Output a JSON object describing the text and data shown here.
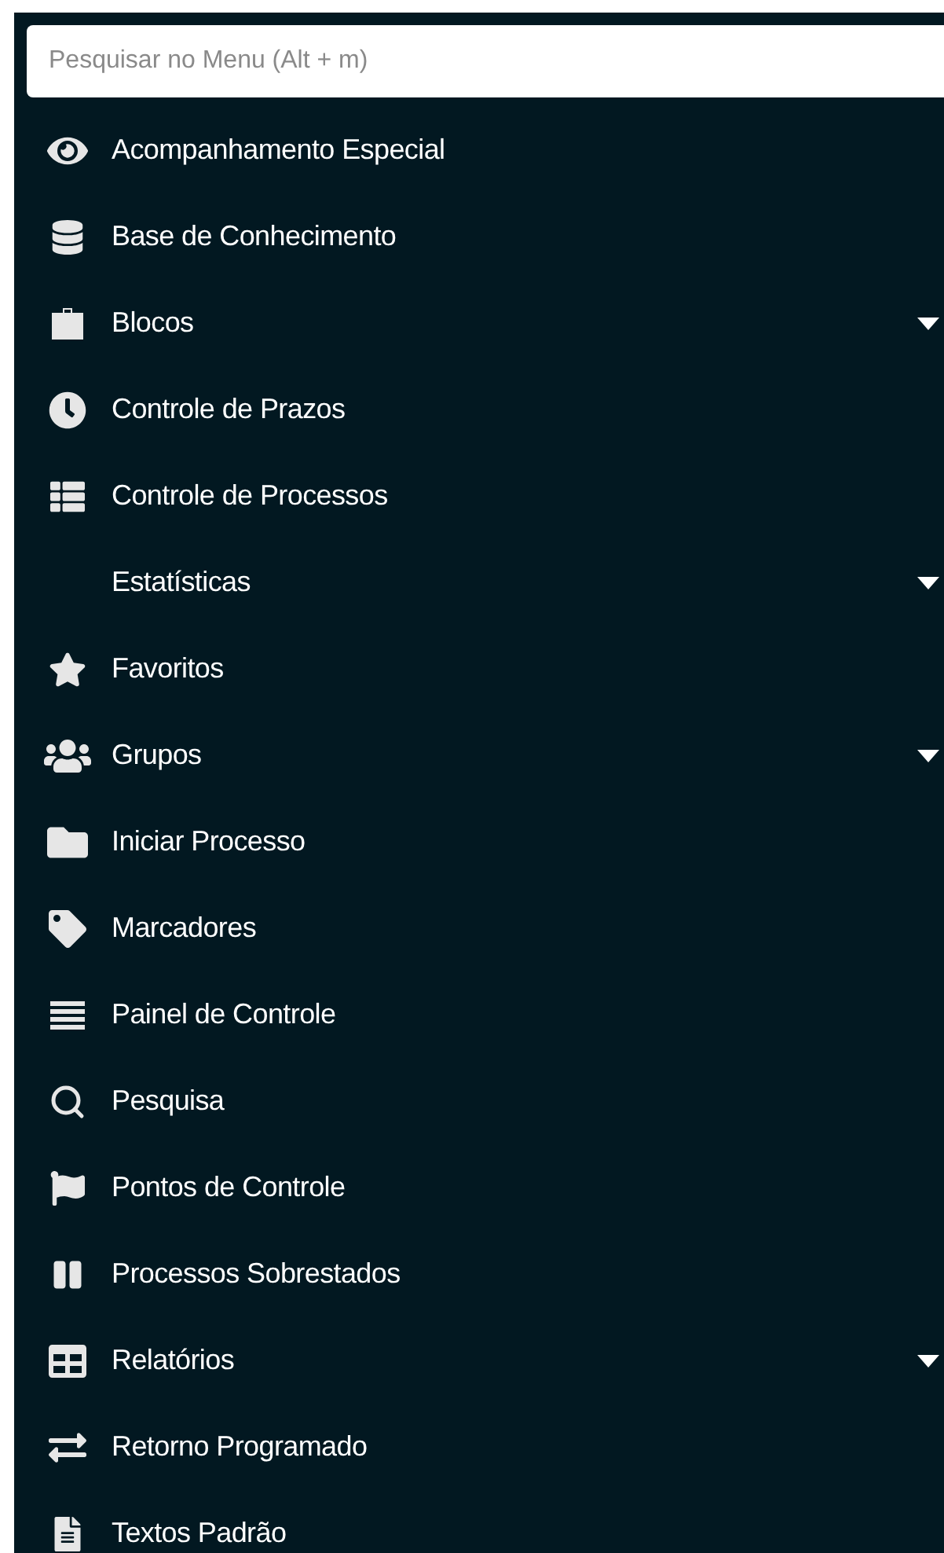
{
  "search": {
    "placeholder": "Pesquisar no Menu (Alt + m)"
  },
  "menu": [
    {
      "label": "Acompanhamento Especial",
      "has_submenu": false
    },
    {
      "label": "Base de Conhecimento",
      "has_submenu": false
    },
    {
      "label": "Blocos",
      "has_submenu": true
    },
    {
      "label": "Controle de Prazos",
      "has_submenu": false
    },
    {
      "label": "Controle de Processos",
      "has_submenu": false
    },
    {
      "label": "Estatísticas",
      "has_submenu": true
    },
    {
      "label": "Favoritos",
      "has_submenu": false
    },
    {
      "label": "Grupos",
      "has_submenu": true
    },
    {
      "label": "Iniciar Processo",
      "has_submenu": false
    },
    {
      "label": "Marcadores",
      "has_submenu": false
    },
    {
      "label": "Painel de Controle",
      "has_submenu": false
    },
    {
      "label": "Pesquisa",
      "has_submenu": false
    },
    {
      "label": "Pontos de Controle",
      "has_submenu": false
    },
    {
      "label": "Processos Sobrestados",
      "has_submenu": false
    },
    {
      "label": "Relatórios",
      "has_submenu": true
    },
    {
      "label": "Retorno Programado",
      "has_submenu": false
    },
    {
      "label": "Textos Padrão",
      "has_submenu": false
    }
  ]
}
